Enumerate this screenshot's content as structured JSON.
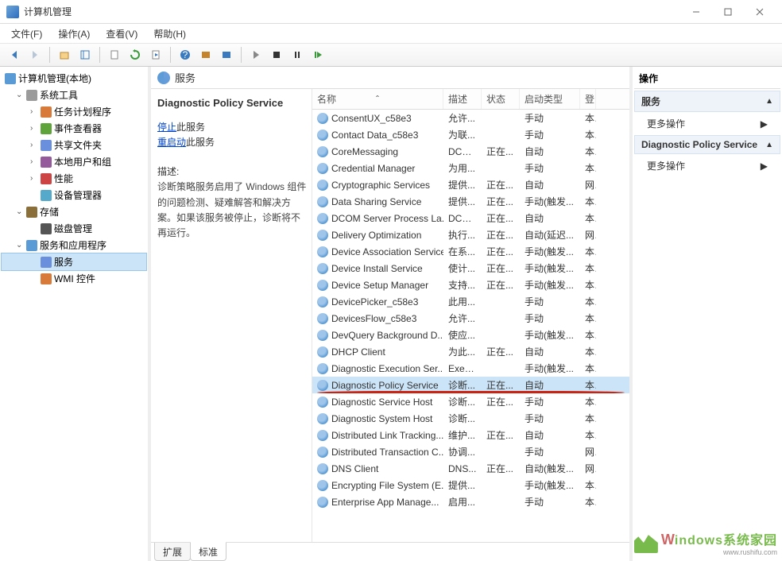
{
  "window": {
    "title": "计算机管理"
  },
  "menu": {
    "file": "文件(F)",
    "action": "操作(A)",
    "view": "查看(V)",
    "help": "帮助(H)"
  },
  "tree": {
    "root": "计算机管理(本地)",
    "system_tools": "系统工具",
    "task_scheduler": "任务计划程序",
    "event_viewer": "事件查看器",
    "shared_folders": "共享文件夹",
    "local_users": "本地用户和组",
    "performance": "性能",
    "device_manager": "设备管理器",
    "storage": "存储",
    "disk_mgmt": "磁盘管理",
    "services_apps": "服务和应用程序",
    "services": "服务",
    "wmi": "WMI 控件"
  },
  "center": {
    "header": "服务",
    "detail_name": "Diagnostic Policy Service",
    "stop_prefix": "停止",
    "stop_suffix": "此服务",
    "restart_prefix": "重启动",
    "restart_suffix": "此服务",
    "desc_label": "描述:",
    "desc_text": "诊断策略服务启用了 Windows 组件的问题检测、疑难解答和解决方案。如果该服务被停止，诊断将不再运行。"
  },
  "columns": {
    "name": "名称",
    "desc": "描述",
    "status": "状态",
    "startup": "启动类型",
    "logon": "登"
  },
  "services": [
    {
      "name": "ConsentUX_c58e3",
      "desc": "允许...",
      "status": "",
      "type": "手动",
      "log": "本"
    },
    {
      "name": "Contact Data_c58e3",
      "desc": "为联...",
      "status": "",
      "type": "手动",
      "log": "本"
    },
    {
      "name": "CoreMessaging",
      "desc": "DCO...",
      "status": "正在...",
      "type": "自动",
      "log": "本"
    },
    {
      "name": "Credential Manager",
      "desc": "为用...",
      "status": "",
      "type": "手动",
      "log": "本"
    },
    {
      "name": "Cryptographic Services",
      "desc": "提供...",
      "status": "正在...",
      "type": "自动",
      "log": "网"
    },
    {
      "name": "Data Sharing Service",
      "desc": "提供...",
      "status": "正在...",
      "type": "手动(触发...",
      "log": "本"
    },
    {
      "name": "DCOM Server Process La...",
      "desc": "DCO...",
      "status": "正在...",
      "type": "自动",
      "log": "本"
    },
    {
      "name": "Delivery Optimization",
      "desc": "执行...",
      "status": "正在...",
      "type": "自动(延迟...",
      "log": "网"
    },
    {
      "name": "Device Association Service",
      "desc": "在系...",
      "status": "正在...",
      "type": "手动(触发...",
      "log": "本"
    },
    {
      "name": "Device Install Service",
      "desc": "使计...",
      "status": "正在...",
      "type": "手动(触发...",
      "log": "本"
    },
    {
      "name": "Device Setup Manager",
      "desc": "支持...",
      "status": "正在...",
      "type": "手动(触发...",
      "log": "本"
    },
    {
      "name": "DevicePicker_c58e3",
      "desc": "此用...",
      "status": "",
      "type": "手动",
      "log": "本"
    },
    {
      "name": "DevicesFlow_c58e3",
      "desc": "允许...",
      "status": "",
      "type": "手动",
      "log": "本"
    },
    {
      "name": "DevQuery Background D...",
      "desc": "使应...",
      "status": "",
      "type": "手动(触发...",
      "log": "本"
    },
    {
      "name": "DHCP Client",
      "desc": "为此...",
      "status": "正在...",
      "type": "自动",
      "log": "本"
    },
    {
      "name": "Diagnostic Execution Ser...",
      "desc": "Exec...",
      "status": "",
      "type": "手动(触发...",
      "log": "本"
    },
    {
      "name": "Diagnostic Policy Service",
      "desc": "诊断...",
      "status": "正在...",
      "type": "自动",
      "log": "本",
      "selected": true,
      "underline": true
    },
    {
      "name": "Diagnostic Service Host",
      "desc": "诊断...",
      "status": "正在...",
      "type": "手动",
      "log": "本"
    },
    {
      "name": "Diagnostic System Host",
      "desc": "诊断...",
      "status": "",
      "type": "手动",
      "log": "本"
    },
    {
      "name": "Distributed Link Tracking...",
      "desc": "维护...",
      "status": "正在...",
      "type": "自动",
      "log": "本"
    },
    {
      "name": "Distributed Transaction C...",
      "desc": "协调...",
      "status": "",
      "type": "手动",
      "log": "网"
    },
    {
      "name": "DNS Client",
      "desc": "DNS...",
      "status": "正在...",
      "type": "自动(触发...",
      "log": "网"
    },
    {
      "name": "Encrypting File System (E...",
      "desc": "提供...",
      "status": "",
      "type": "手动(触发...",
      "log": "本"
    },
    {
      "name": "Enterprise App Manage...",
      "desc": "启用...",
      "status": "",
      "type": "手动",
      "log": "本"
    }
  ],
  "tabs": {
    "extended": "扩展",
    "standard": "标准"
  },
  "actions": {
    "title": "操作",
    "services": "服务",
    "more1": "更多操作",
    "dps": "Diagnostic Policy Service",
    "more2": "更多操作"
  },
  "watermark": {
    "text": "indows系统家园",
    "sub": "www.rushifu.com"
  }
}
